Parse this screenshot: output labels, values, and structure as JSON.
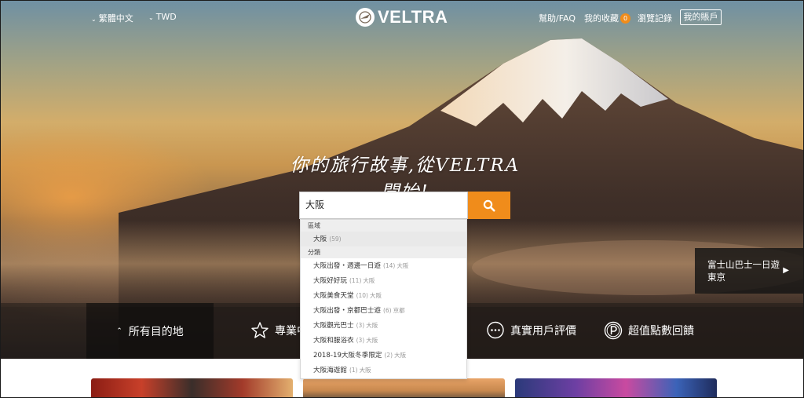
{
  "header": {
    "language": "繁體中文",
    "currency": "TWD",
    "logo_text": "VELTRA",
    "help": "幫助/FAQ",
    "favorites": "我的收藏",
    "favorites_count": "0",
    "history": "瀏覽記錄",
    "account": "我的賬戶"
  },
  "hero": {
    "tagline": "你的旅行故事,從VELTRA開始!"
  },
  "search": {
    "value": "大阪"
  },
  "suggestions": {
    "section_region": "區域",
    "region_items": [
      {
        "label": "大阪",
        "count": "(59)"
      }
    ],
    "section_category": "分類",
    "category_items": [
      {
        "label": "大阪出發・週邊一日遊",
        "count": "(14)",
        "region": "大阪"
      },
      {
        "label": "大阪好好玩",
        "count": "(11)",
        "region": "大阪"
      },
      {
        "label": "大阪美食天堂",
        "count": "(10)",
        "region": "大阪"
      },
      {
        "label": "大阪出發・京都巴士遊",
        "count": "(6)",
        "region": "京都"
      },
      {
        "label": "大阪觀光巴士",
        "count": "(3)",
        "region": "大阪"
      },
      {
        "label": "大阪和服浴衣",
        "count": "(3)",
        "region": "大阪"
      },
      {
        "label": "2018-19大阪冬季限定",
        "count": "(2)",
        "region": "大阪"
      },
      {
        "label": "大阪海遊館",
        "count": "(1)",
        "region": "大阪"
      }
    ]
  },
  "feature": {
    "line1": "富士山巴士一日遊",
    "line2": "東京"
  },
  "categories": {
    "all_destinations": "所有目的地",
    "professional": "專業中",
    "reviews": "真實用戶評價",
    "points": "超值點數回饋"
  },
  "colors": {
    "accent": "#f08c1b"
  }
}
